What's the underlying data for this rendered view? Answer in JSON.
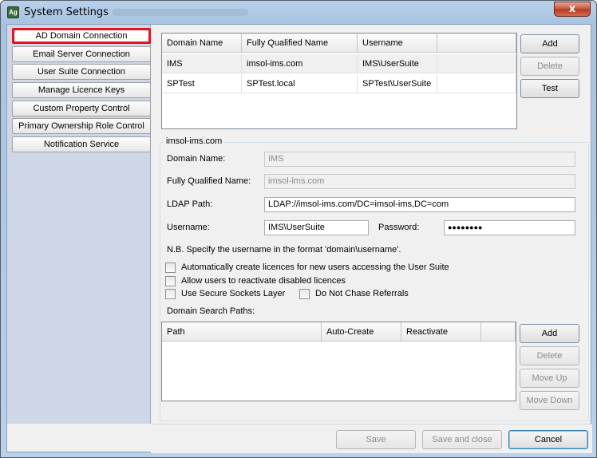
{
  "window": {
    "title": "System Settings",
    "close_glyph": "x",
    "app_icon_text": "Ag"
  },
  "sidebar": {
    "items": [
      {
        "label": "AD Domain Connection",
        "selected": true
      },
      {
        "label": "Email Server Connection"
      },
      {
        "label": "User Suite Connection"
      },
      {
        "label": "Manage Licence Keys"
      },
      {
        "label": "Custom Property Control"
      },
      {
        "label": "Primary Ownership Role Control"
      },
      {
        "label": "Notification Service"
      }
    ]
  },
  "domains": {
    "columns": [
      "Domain Name",
      "Fully Qualified Name",
      "Username",
      ""
    ],
    "rows": [
      [
        "IMS",
        "imsol-ims.com",
        "IMS\\UserSuite",
        ""
      ],
      [
        "SPTest",
        "SPTest.local",
        "SPTest\\UserSuite",
        ""
      ]
    ],
    "buttons": {
      "add": "Add",
      "delete": "Delete",
      "test": "Test"
    }
  },
  "details": {
    "group_title": "imsol-ims.com",
    "domain_name_label": "Domain Name:",
    "domain_name_value": "IMS",
    "fqn_label": "Fully Qualified Name:",
    "fqn_value": "imsol-ims.com",
    "ldap_label": "LDAP Path:",
    "ldap_value": "LDAP://imsol-ims.com/DC=imsol-ims,DC=com",
    "username_label": "Username:",
    "username_value": "IMS\\UserSuite",
    "password_label": "Password:",
    "password_value": "●●●●●●●●",
    "note": "N.B. Specify the username in the format 'domain\\username'.",
    "checkboxes": {
      "auto_create": "Automatically create licences for new users accessing the User Suite",
      "reactivate": "Allow users to reactivate disabled licences",
      "ssl": "Use Secure Sockets Layer",
      "no_chase": "Do Not Chase Referrals"
    },
    "search_paths_label": "Domain Search Paths:",
    "search_columns": [
      "Path",
      "Auto-Create",
      "Reactivate",
      ""
    ],
    "search_buttons": {
      "add": "Add",
      "delete": "Delete",
      "move_up": "Move Up",
      "move_down": "Move Down"
    }
  },
  "footer": {
    "save": "Save",
    "save_close": "Save and close",
    "cancel": "Cancel"
  }
}
